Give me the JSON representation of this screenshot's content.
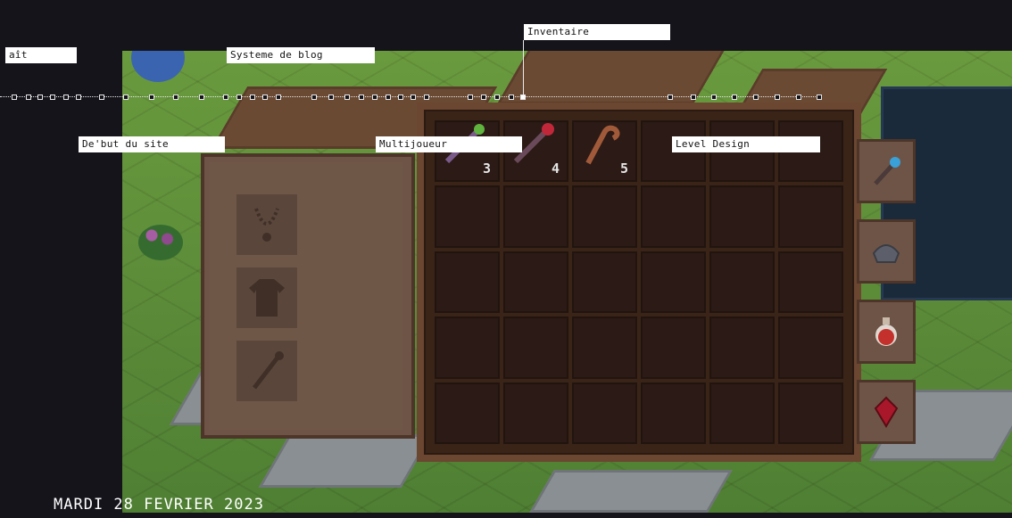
{
  "timeline": {
    "labels": [
      {
        "id": "ait",
        "text": "aît"
      },
      {
        "id": "blog",
        "text": "Systeme de blog"
      },
      {
        "id": "inventaire",
        "text": "Inventaire"
      },
      {
        "id": "debut",
        "text": "De'but du site"
      },
      {
        "id": "multi",
        "text": "Multijoueur"
      },
      {
        "id": "level",
        "text": "Level Design"
      }
    ]
  },
  "inventory": {
    "quantities": [
      "3",
      "4",
      "5"
    ],
    "items": [
      "green-wand-icon",
      "red-wand-icon",
      "wooden-staff-icon"
    ]
  },
  "equipment": {
    "slots": [
      "necklace-slot-icon",
      "tunic-slot-icon",
      "wand-slot-icon"
    ]
  },
  "quickslots": [
    "blue-wand-icon",
    "armor-helmet-icon",
    "red-potion-icon",
    "red-gem-icon"
  ],
  "date": "MARDI 28 FEVRIER 2023",
  "colors": {
    "background": "#15141b",
    "panel": "#6e5446",
    "inventory_bg": "#3a2418",
    "label_bg": "#ffffff"
  }
}
